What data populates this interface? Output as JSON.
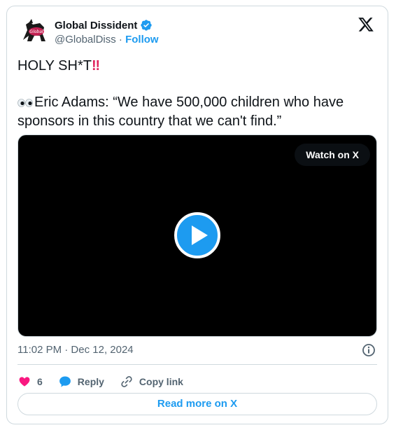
{
  "author": {
    "display_name": "Global Dissident",
    "handle": "@GlobalDiss",
    "separator": " · ",
    "follow_label": "Follow",
    "avatar_icon": "horse-logo-avatar",
    "verified_icon": "verified-badge-icon"
  },
  "tweet": {
    "line1": "HOLY SH*T",
    "line1_emoji": "‼",
    "line2_emoji": "👀",
    "line2": "Eric Adams: “We have 500,000 children who have sponsors in this country that we can't find.”"
  },
  "media": {
    "watch_label": "Watch on X",
    "play_icon": "play-icon"
  },
  "meta": {
    "timestamp": "11:02 PM · Dec 12, 2024",
    "info_icon": "info-icon"
  },
  "actions": {
    "like_count": "6",
    "reply_label": "Reply",
    "copy_label": "Copy link"
  },
  "footer": {
    "read_more_label": "Read more on X"
  },
  "colors": {
    "accent": "#1d9bf0",
    "like": "#f91880",
    "text": "#0f1419",
    "muted": "#536471",
    "border": "#cfd9de"
  }
}
